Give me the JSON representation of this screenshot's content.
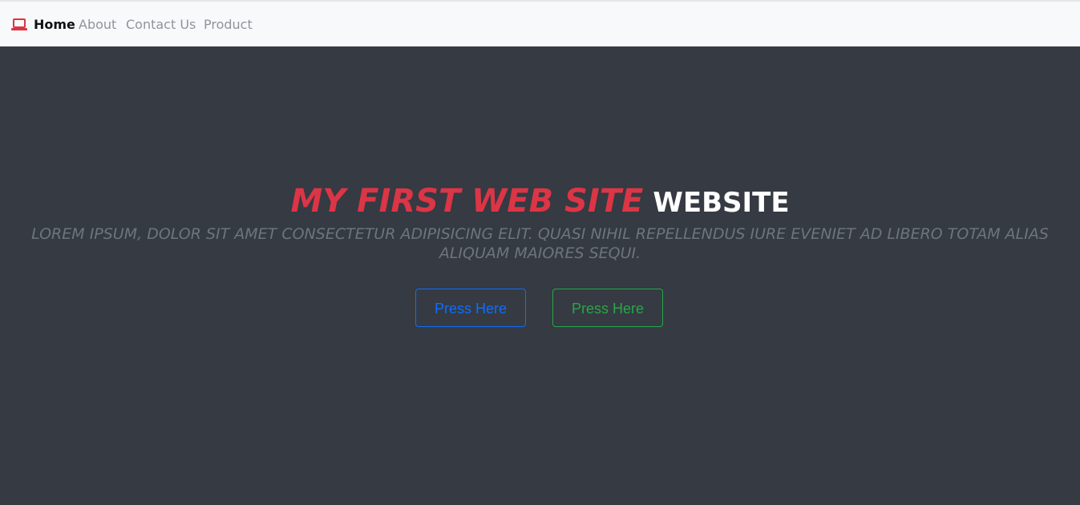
{
  "nav": {
    "brand_icon": "laptop-icon",
    "items": [
      {
        "label": "Home",
        "active": true
      },
      {
        "label": "About",
        "active": false
      },
      {
        "label": "Contact Us",
        "active": false
      },
      {
        "label": "Product",
        "active": false
      }
    ]
  },
  "hero": {
    "title_main": "MY FIRST WEB SITE",
    "title_secondary": "WEBSITE",
    "subtitle": "LOREM IPSUM, DOLOR SIT AMET CONSECTETUR ADIPISICING ELIT. QUASI NIHIL REPELLENDUS IURE EVENIET AD LIBERO TOTAM ALIAS ALIQUAM MAIORES SEQUI.",
    "buttons": [
      {
        "label": "Press Here",
        "style": "outline-primary"
      },
      {
        "label": "Press Here",
        "style": "outline-success"
      }
    ]
  },
  "colors": {
    "navbar_bg": "#f8f9fa",
    "hero_bg": "#353a43",
    "title_accent": "#dc3545",
    "title_secondary": "#ffffff",
    "subtitle": "#6c757d",
    "primary": "#0d6efd",
    "success": "#28a745",
    "brand_icon": "#dc3545"
  }
}
